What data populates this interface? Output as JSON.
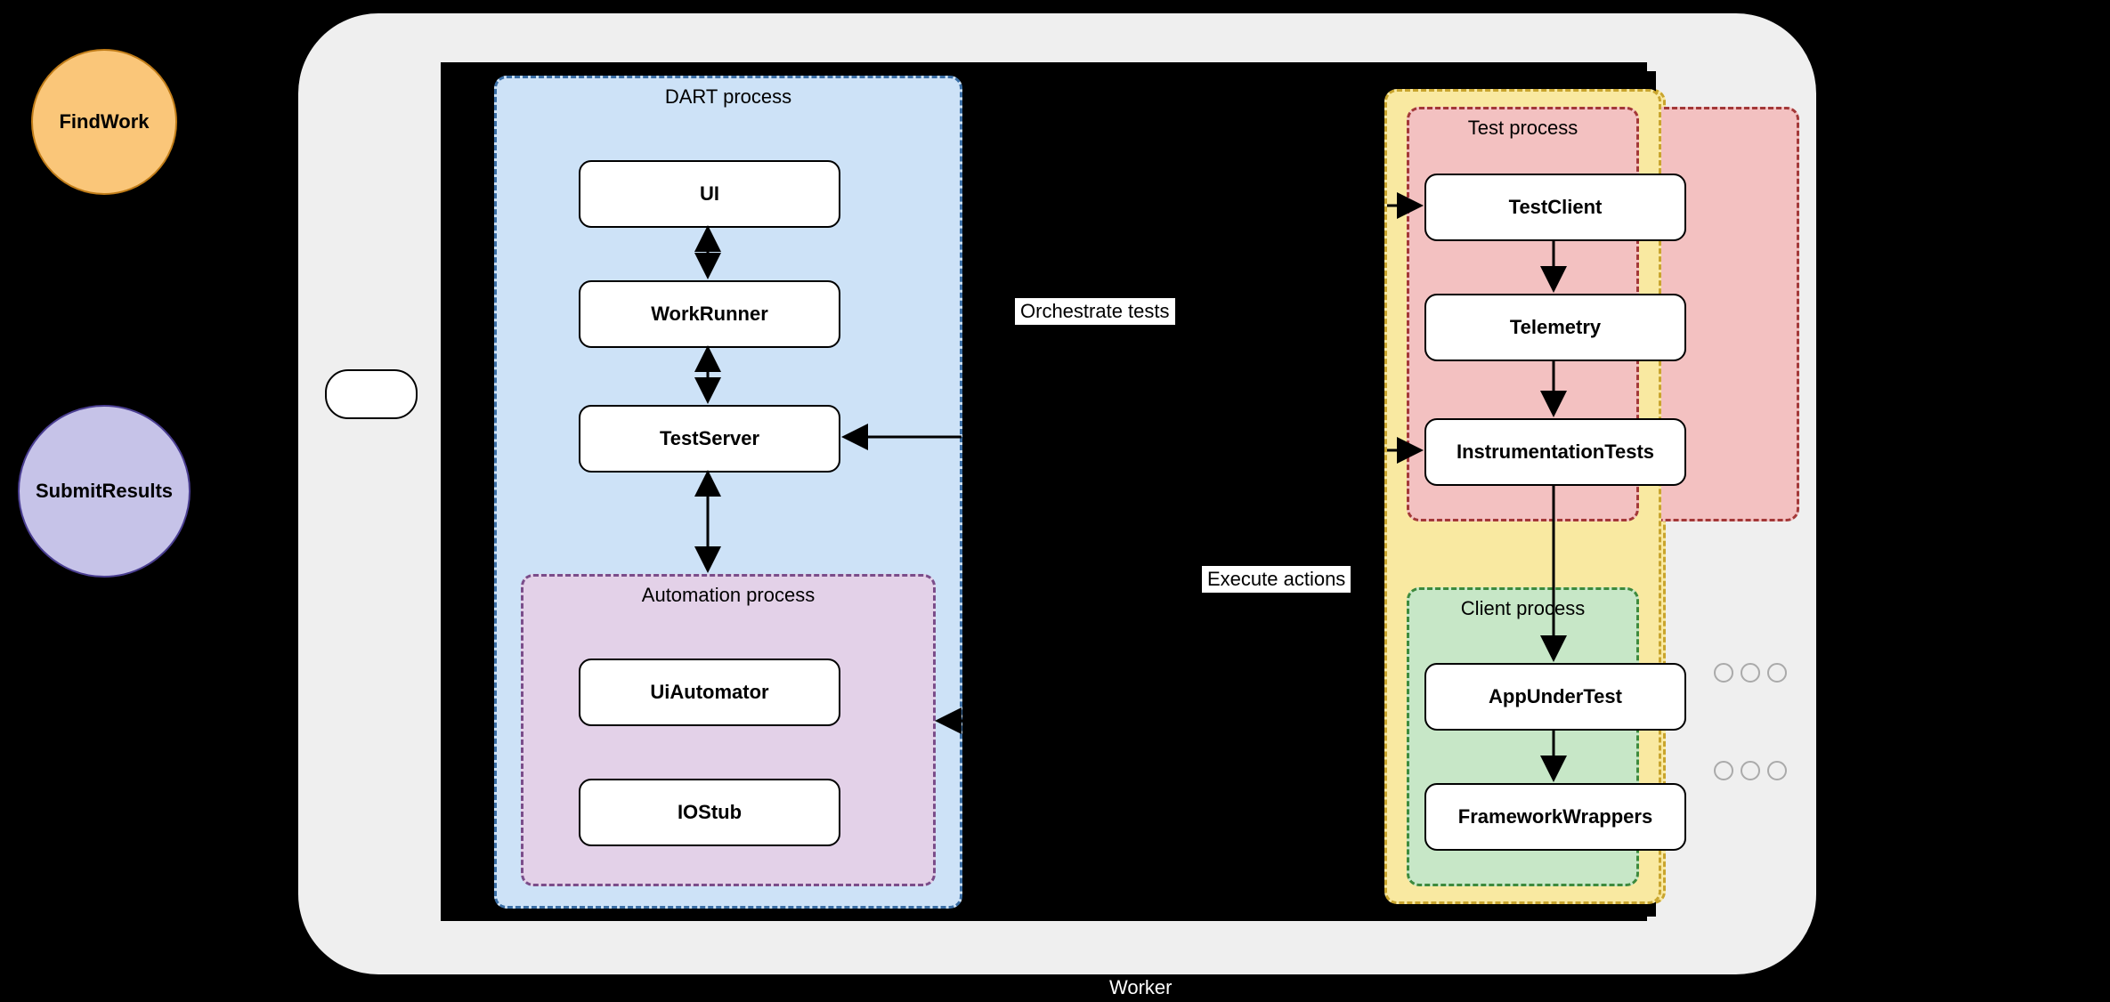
{
  "circles": {
    "findwork": "FindWork",
    "submitresults": "SubmitResults"
  },
  "worker_label": "Worker",
  "dart": {
    "title": "DART process",
    "ui": "UI",
    "workrunner": "WorkRunner",
    "testserver": "TestServer"
  },
  "automation": {
    "title": "Automation process",
    "uiautomator": "UiAutomator",
    "iostub": "IOStub"
  },
  "labels": {
    "orchestrate": "Orchestrate tests",
    "execute": "Execute actions"
  },
  "test": {
    "title": "Test process",
    "testclient": "TestClient",
    "telemetry": "Telemetry",
    "instrumentation": "InstrumentationTests"
  },
  "client": {
    "title": "Client process",
    "app": "AppUnderTest",
    "wrappers": "FrameworkWrappers"
  }
}
